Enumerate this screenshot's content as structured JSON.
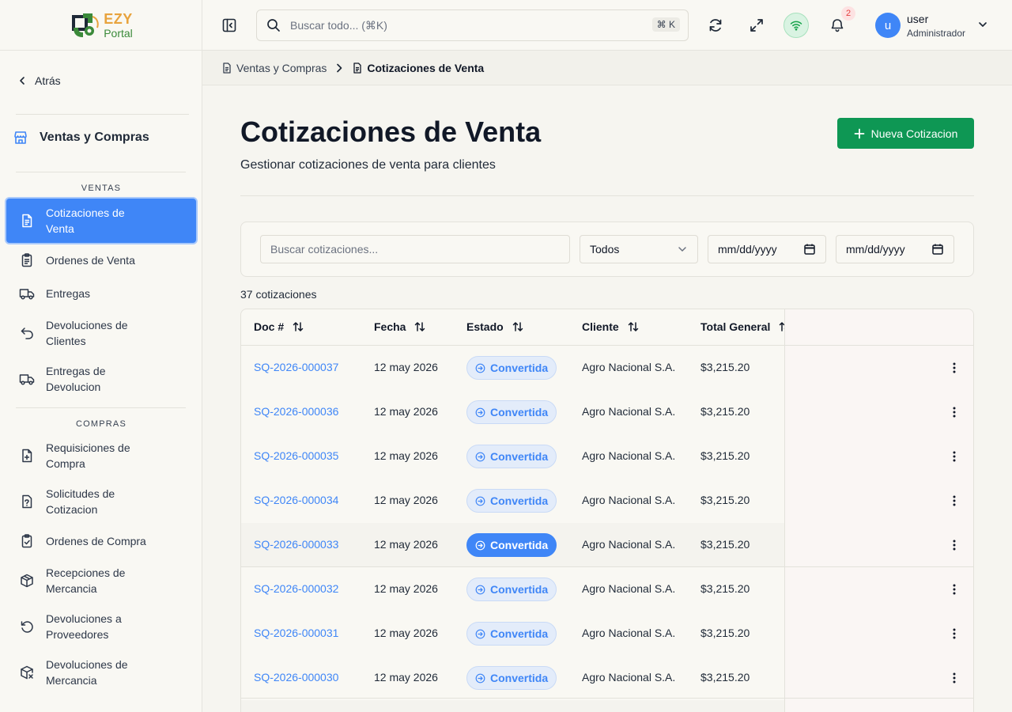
{
  "logo": {
    "line1": "EZY",
    "line2": "Portal"
  },
  "sidebar": {
    "back_label": "Atrás",
    "module_title": "Ventas y Compras",
    "sections": [
      {
        "label": "VENTAS",
        "items": [
          {
            "label": "Cotizaciones de Venta",
            "icon": "document-icon",
            "active": true
          },
          {
            "label": "Ordenes de Venta",
            "icon": "clipboard-list-icon"
          },
          {
            "label": "Entregas",
            "icon": "truck-icon"
          },
          {
            "label": "Devoluciones de Clientes",
            "icon": "undo-icon"
          },
          {
            "label": "Entregas de Devolucion",
            "icon": "truck-return-icon"
          }
        ]
      },
      {
        "label": "COMPRAS",
        "items": [
          {
            "label": "Requisiciones de Compra",
            "icon": "file-plus-icon"
          },
          {
            "label": "Solicitudes de Cotizacion",
            "icon": "file-question-icon"
          },
          {
            "label": "Ordenes de Compra",
            "icon": "clipboard-check-icon"
          },
          {
            "label": "Recepciones de Mercancia",
            "icon": "package-icon"
          },
          {
            "label": "Devoluciones a Proveedores",
            "icon": "rotate-ccw-icon"
          },
          {
            "label": "Devoluciones de Mercancia",
            "icon": "package-x-icon"
          }
        ]
      }
    ]
  },
  "topbar": {
    "search_placeholder": "Buscar todo... (⌘K)",
    "search_shortcut": "⌘ K",
    "notification_count": "2",
    "user": {
      "initial": "u",
      "name": "user",
      "role": "Administrador"
    }
  },
  "breadcrumb": {
    "parent": "Ventas y Compras",
    "current": "Cotizaciones de Venta"
  },
  "page": {
    "title": "Cotizaciones de Venta",
    "subtitle": "Gestionar cotizaciones de venta para clientes",
    "new_button": "Nueva Cotizacion"
  },
  "filters": {
    "search_placeholder": "Buscar cotizaciones...",
    "status_value": "Todos",
    "date_from": "mm/dd/yyyy",
    "date_to": "mm/dd/yyyy"
  },
  "table": {
    "count_label": "37 cotizaciones",
    "columns": [
      "Doc #",
      "Fecha",
      "Estado",
      "Cliente",
      "Total General"
    ],
    "rows": [
      {
        "doc": "SQ-2026-000037",
        "fecha": "12 may 2026",
        "estado": "Convertida",
        "cliente": "Agro Nacional S.A.",
        "total": "$3,215.20"
      },
      {
        "doc": "SQ-2026-000036",
        "fecha": "12 may 2026",
        "estado": "Convertida",
        "cliente": "Agro Nacional S.A.",
        "total": "$3,215.20"
      },
      {
        "doc": "SQ-2026-000035",
        "fecha": "12 may 2026",
        "estado": "Convertida",
        "cliente": "Agro Nacional S.A.",
        "total": "$3,215.20"
      },
      {
        "doc": "SQ-2026-000034",
        "fecha": "12 may 2026",
        "estado": "Convertida",
        "cliente": "Agro Nacional S.A.",
        "total": "$3,215.20"
      },
      {
        "doc": "SQ-2026-000033",
        "fecha": "12 may 2026",
        "estado": "Convertida",
        "cliente": "Agro Nacional S.A.",
        "total": "$3,215.20",
        "highlighted": true
      },
      {
        "doc": "SQ-2026-000032",
        "fecha": "12 may 2026",
        "estado": "Convertida",
        "cliente": "Agro Nacional S.A.",
        "total": "$3,215.20"
      },
      {
        "doc": "SQ-2026-000031",
        "fecha": "12 may 2026",
        "estado": "Convertida",
        "cliente": "Agro Nacional S.A.",
        "total": "$3,215.20"
      },
      {
        "doc": "SQ-2026-000030",
        "fecha": "12 may 2026",
        "estado": "Convertida",
        "cliente": "Agro Nacional S.A.",
        "total": "$3,215.20"
      }
    ]
  },
  "colors": {
    "accent": "#3f86f7",
    "primary_button": "#0e9754",
    "status_bg": "#e3ecfa"
  }
}
